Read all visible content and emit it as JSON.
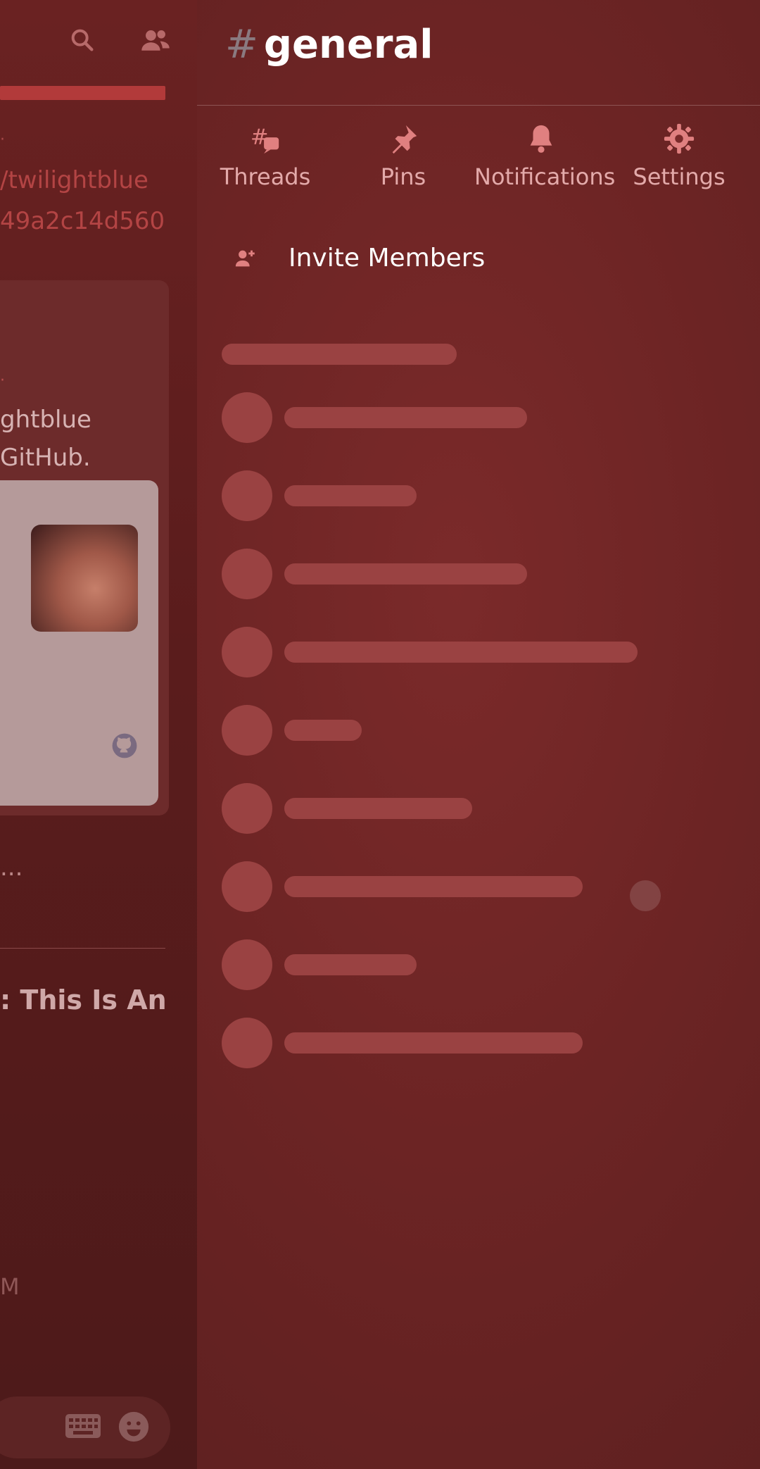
{
  "left_panel": {
    "link_line1": "/twilightblue",
    "link_line2": "49a2c14d560",
    "card_line1": "ghtblue",
    "card_line2": "GitHub.",
    "ellipsis": "...",
    "message_title": ": This Is An",
    "time_fragment": "M"
  },
  "channel": {
    "hash": "#",
    "name": "general"
  },
  "tabs": [
    {
      "label": "Threads",
      "icon": "threads-icon"
    },
    {
      "label": "Pins",
      "icon": "pin-icon"
    },
    {
      "label": "Notifications",
      "icon": "bell-icon"
    },
    {
      "label": "Settings",
      "icon": "gear-icon"
    }
  ],
  "invite": {
    "label": "Invite Members",
    "icon": "add-user-icon"
  },
  "colors": {
    "accent": "#b23a3a",
    "skeleton": "#9a4242",
    "tab_text": "#e3aaaa"
  }
}
